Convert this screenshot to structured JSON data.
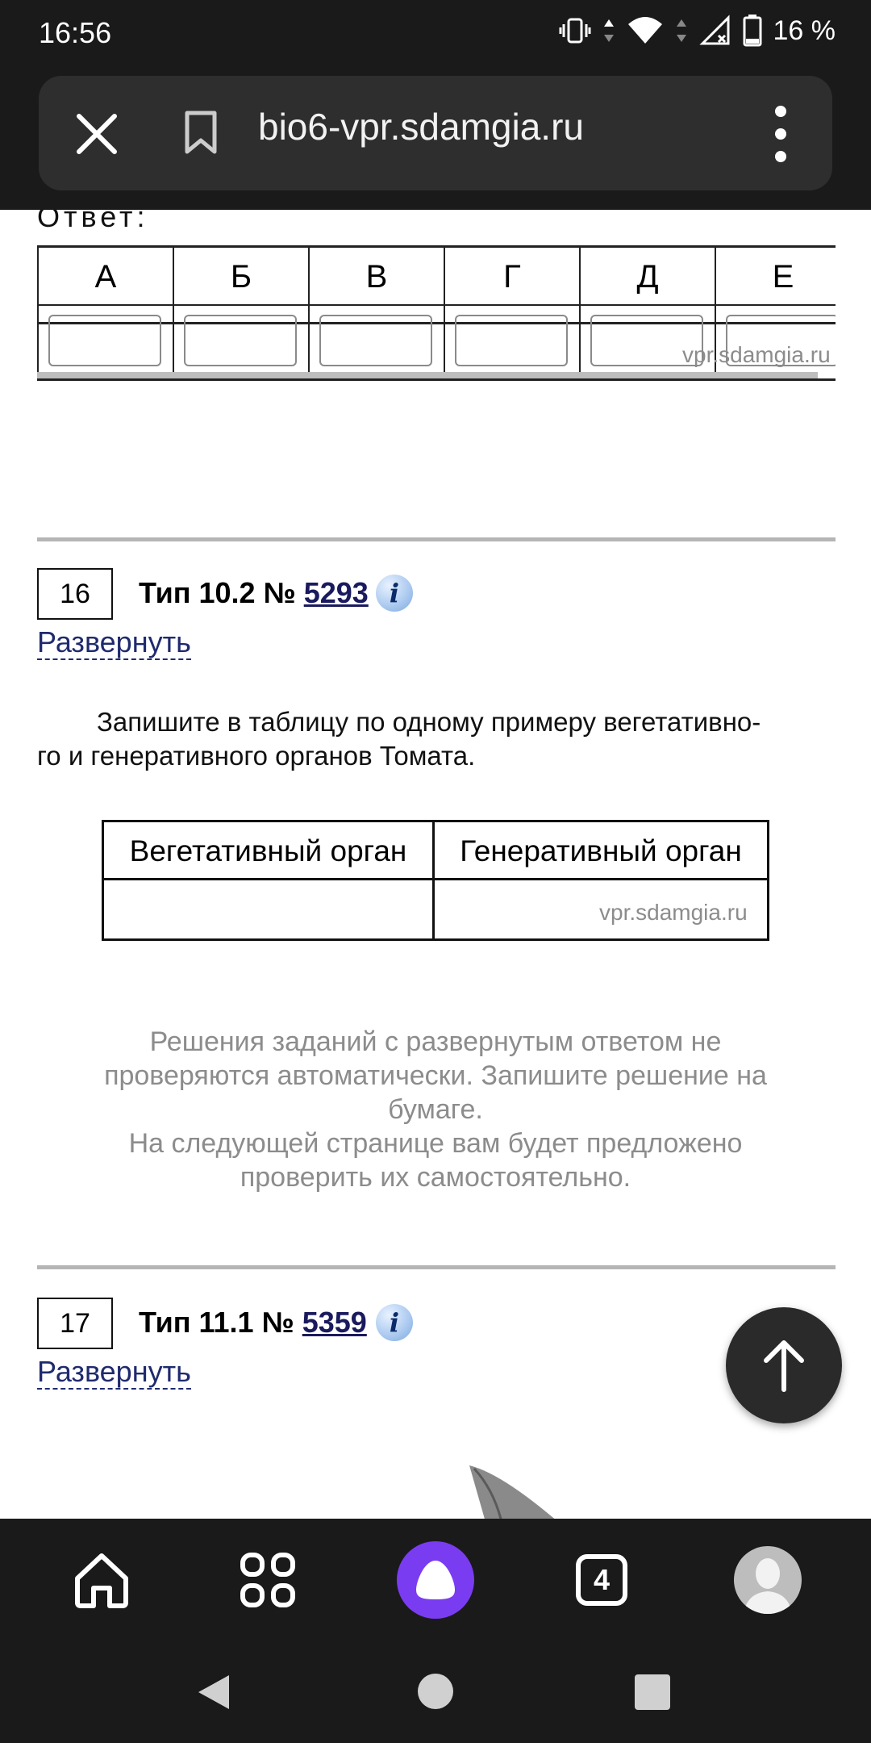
{
  "status_bar": {
    "time": "16:56",
    "battery_percent": "16 %"
  },
  "browser": {
    "url": "bio6-vpr.sdamgia.ru"
  },
  "answer_block": {
    "label": "Ответ:",
    "columns": [
      "А",
      "Б",
      "В",
      "Г",
      "Д",
      "Е"
    ],
    "watermark": "vpr.sdamgia.ru"
  },
  "task16": {
    "number": "16",
    "type_prefix": "Тип 10.2 № ",
    "id": "5293",
    "info_label": "i",
    "expand": "Развернуть",
    "text_line1": "Запишите в таблицу по одному примеру вегетативно-",
    "text_line2": "го и генеративного органов Томата.",
    "table": {
      "headers": [
        "Вегетативный орган",
        "Генеративный орган"
      ],
      "watermark": "vpr.sdamgia.ru"
    },
    "note_line1": "Решения заданий с развернутым ответом не",
    "note_line2": "проверяются автоматически. Запишите решение на",
    "note_line3": "бумаге.",
    "note_line4": "На следующей странице вам будет предложено",
    "note_line5": "проверить их самостоятельно."
  },
  "task17": {
    "number": "17",
    "type_prefix": "Тип 11.1 № ",
    "id": "5359",
    "info_label": "i",
    "expand": "Развернуть"
  },
  "bottom_bar": {
    "tabs_count": "4"
  },
  "colors": {
    "alice": "#7a3cf0",
    "link": "#1f2a6e",
    "bar": "#1a1a1a"
  }
}
